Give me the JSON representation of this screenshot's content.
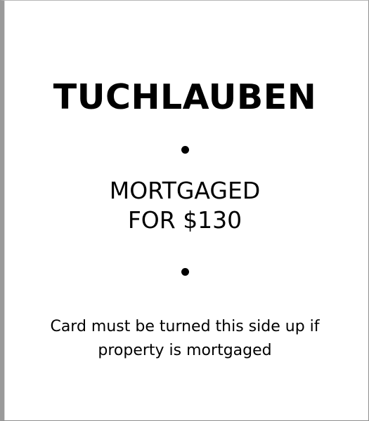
{
  "card": {
    "property_name": "TUCHLAUBEN",
    "mortgage_line_1": "MORTGAGED",
    "mortgage_line_2": "FOR $130",
    "note_line_1": "Card must be turned this side up if",
    "note_line_2": "property is mortgaged"
  },
  "colors": {
    "text": "#000000",
    "background": "#ffffff",
    "border": "#9a9a9a"
  }
}
